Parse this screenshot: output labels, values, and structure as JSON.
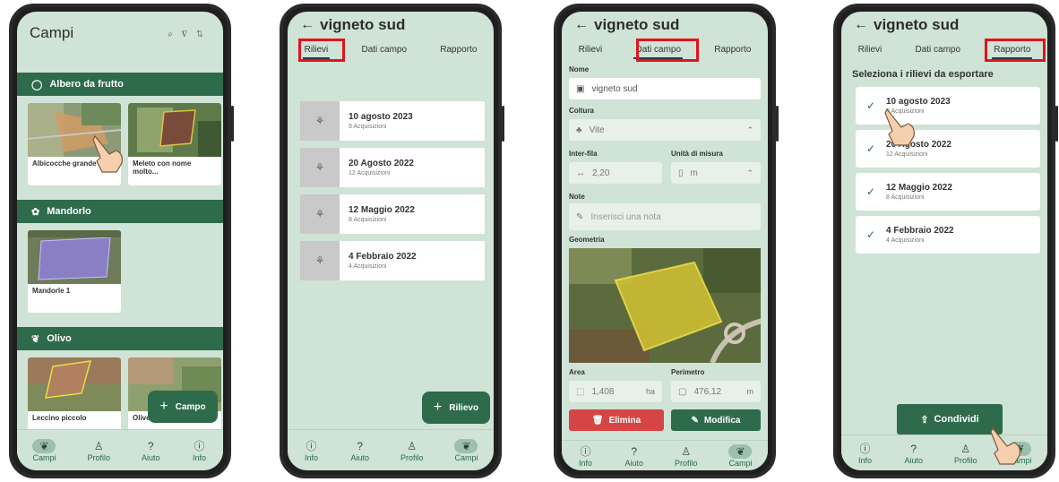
{
  "icons": {
    "back": "←",
    "search": "⌕",
    "filter": "∇",
    "sort": "⇅",
    "plus": "+",
    "check": "✓",
    "chevron": "⌃"
  },
  "colors": {
    "accent": "#2e6b4a",
    "screen_bg": "#cfe3d6",
    "highlight": "#e0141c",
    "danger": "#d64545"
  },
  "nav": {
    "campi": "Campi",
    "profilo": "Profilo",
    "aiuto": "Aiuto",
    "info": "Info"
  },
  "screen1": {
    "title": "Campi",
    "sections": [
      {
        "label": "Albero da frutto",
        "cards": [
          "Albicocche grande",
          "Meleto con nome molto..."
        ]
      },
      {
        "label": "Mandorlo",
        "cards": [
          "Mandorle 1"
        ]
      },
      {
        "label": "Olivo",
        "cards": [
          "Leccino piccolo",
          "Oliveto 1"
        ]
      }
    ],
    "fab": "Campo"
  },
  "screen2": {
    "title": "vigneto sud",
    "tabs": [
      "Rilievi",
      "Dati campo",
      "Rapporto"
    ],
    "items": [
      {
        "date": "10 agosto 2023",
        "count": "9 Acquisizioni"
      },
      {
        "date": "20 Agosto 2022",
        "count": "12 Acquisizioni"
      },
      {
        "date": "12 Maggio 2022",
        "count": "8 Acquisizioni"
      },
      {
        "date": "4 Febbraio 2022",
        "count": "4 Acquisizioni"
      }
    ],
    "fab": "Rilievo"
  },
  "screen3": {
    "title": "vigneto sud",
    "tabs": [
      "Rilievi",
      "Dati campo",
      "Rapporto"
    ],
    "nome_label": "Nome",
    "nome_value": "vigneto sud",
    "coltura_label": "Coltura",
    "coltura_value": "Vite",
    "interfila_label": "Inter-fila",
    "interfila_value": "2,20",
    "unita_label": "Unità di misura",
    "unita_value": "m",
    "note_label": "Note",
    "note_placeholder": "Inserisci una nota",
    "geometria_label": "Geometria",
    "area_label": "Area",
    "area_value": "1,408",
    "area_unit": "ha",
    "perimetro_label": "Perimetro",
    "perimetro_value": "476,12",
    "perimetro_unit": "m",
    "elimina": "Elimina",
    "modifica": "Modifica"
  },
  "screen4": {
    "title": "vigneto sud",
    "tabs": [
      "Rilievi",
      "Dati campo",
      "Rapporto"
    ],
    "heading": "Seleziona i rilievi da esportare",
    "items": [
      {
        "date": "10 agosto 2023",
        "count": "9 Acquisizioni"
      },
      {
        "date": "20 Agosto 2022",
        "count": "12 Acquisizioni"
      },
      {
        "date": "12 Maggio 2022",
        "count": "8 Acquisizioni"
      },
      {
        "date": "4 Febbraio 2022",
        "count": "4 Acquisizioni"
      }
    ],
    "condividi": "Condividi"
  }
}
